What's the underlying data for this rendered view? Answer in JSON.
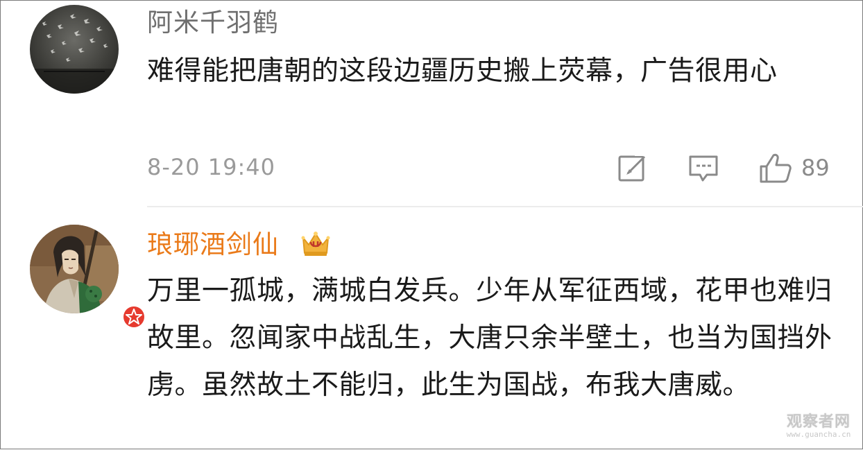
{
  "comments": [
    {
      "username": "阿米千羽鹤",
      "avatar_icon": "flying-cranes-avatar-icon",
      "text": "难得能把唐朝的这段边疆历史搬上荧幕，广告很用心",
      "timestamp": "8-20 19:40",
      "actions": {
        "repost_icon": "repost-icon",
        "comment_icon": "comment-bubble-icon",
        "like_icon": "thumbs-up-icon",
        "like_count": "89"
      }
    },
    {
      "username": "琅琊酒剑仙",
      "avatar_icon": "swordsman-portrait-avatar-icon",
      "vip_badge_icon": "red-verified-star-badge-icon",
      "crown_icon": "gold-crown-icon",
      "text": "万里一孤城，满城白发兵。少年从军征西域，花甲也难归故里。忽闻家中战乱生，大唐只余半壁土，也当为国挡外虏。虽然故土不能归，此生为国战，布我大唐威。"
    }
  ],
  "watermark": {
    "title": "观察者网",
    "url": "www.guancha.cn"
  },
  "colors": {
    "username_normal": "#6f6f6f",
    "username_vip": "#ea7a19",
    "text": "#1a1a1a",
    "meta": "#9a9a9a",
    "badge_red": "#e63a2e",
    "crown_gold": "#f2b33d"
  }
}
